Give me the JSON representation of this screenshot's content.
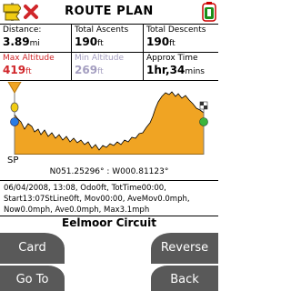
{
  "header": {
    "title": "ROUTE PLAN"
  },
  "stats": {
    "distance": {
      "label": "Distance:",
      "value": "3.89",
      "unit": "mi"
    },
    "total_ascents": {
      "label": "Total Ascents",
      "value": "190",
      "unit": "ft"
    },
    "total_descents": {
      "label": "Total Descents",
      "value": "190",
      "unit": "ft"
    },
    "max_altitude": {
      "label": "Max Altitude",
      "value": "419",
      "unit": "ft"
    },
    "min_altitude": {
      "label": "Min Altitude",
      "value": "269",
      "unit": "ft"
    },
    "approx_time": {
      "label": "Approx Time",
      "value": "1hr,34",
      "unit": "mins"
    }
  },
  "chart": {
    "start_label": "SP",
    "coordinates": "N051.25296° : W000.81123°"
  },
  "track_info": {
    "line1": "06/04/2008, 13:08, Odo0ft, TotTime00:00,",
    "line2": "Start13:07StLine0ft, Mov00:00, AveMov0.0mph,",
    "line3": "Now0.0mph, Ave0.0mph, Max3.1mph"
  },
  "route_name": "Eelmoor Circuit",
  "buttons": {
    "card": "Card",
    "reverse": "Reverse",
    "go_to": "Go To",
    "back": "Back"
  },
  "colors": {
    "fill": "#f0a423",
    "accent_red": "#d0262a",
    "button_bg": "#595959"
  },
  "icons": {
    "logo": "yellow-signpost-icon",
    "close": "red-x-icon",
    "battery": "battery-icon"
  }
}
